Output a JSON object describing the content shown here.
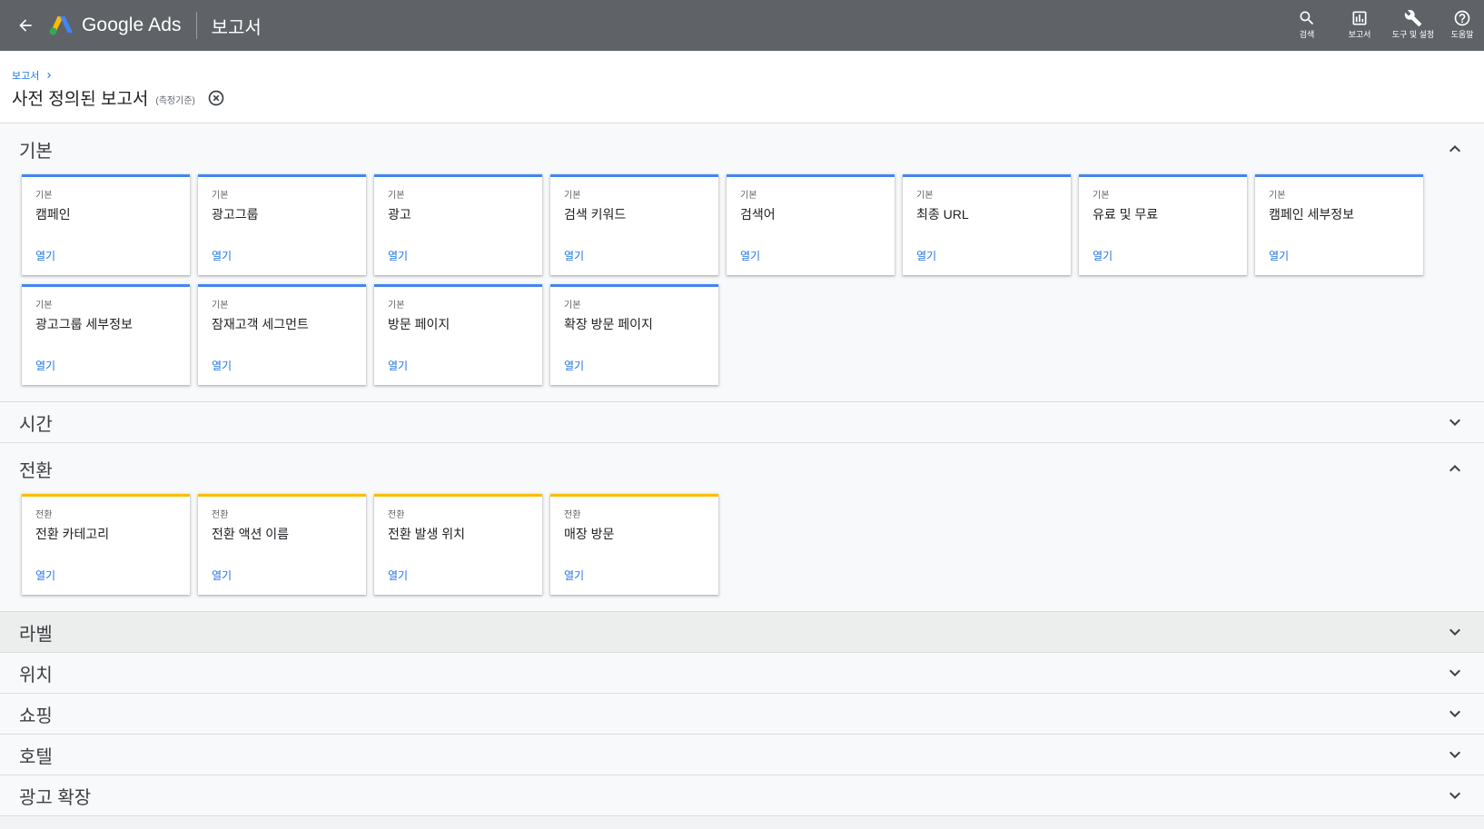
{
  "topbar": {
    "product_name": "Google Ads",
    "page_name": "보고서",
    "actions": [
      {
        "label": "검색",
        "icon": "search-icon"
      },
      {
        "label": "보고서",
        "icon": "reports-icon"
      },
      {
        "label": "도구 및 설정",
        "icon": "wrench-icon"
      },
      {
        "label": "도움말",
        "icon": "help-icon"
      }
    ]
  },
  "header": {
    "breadcrumb": "보고서",
    "title": "사전 정의된 보고서",
    "subnote": "(측정기준)"
  },
  "sections": {
    "basic": {
      "name": "기본",
      "cards": [
        {
          "category": "기본",
          "name": "캠페인",
          "open": "열기"
        },
        {
          "category": "기본",
          "name": "광고그룹",
          "open": "열기"
        },
        {
          "category": "기본",
          "name": "광고",
          "open": "열기"
        },
        {
          "category": "기본",
          "name": "검색 키워드",
          "open": "열기"
        },
        {
          "category": "기본",
          "name": "검색어",
          "open": "열기"
        },
        {
          "category": "기본",
          "name": "최종 URL",
          "open": "열기"
        },
        {
          "category": "기본",
          "name": "유료 및 무료",
          "open": "열기"
        },
        {
          "category": "기본",
          "name": "캠페인 세부정보",
          "open": "열기"
        },
        {
          "category": "기본",
          "name": "광고그룹 세부정보",
          "open": "열기"
        },
        {
          "category": "기본",
          "name": "잠재고객 세그먼트",
          "open": "열기"
        },
        {
          "category": "기본",
          "name": "방문 페이지",
          "open": "열기"
        },
        {
          "category": "기본",
          "name": "확장 방문 페이지",
          "open": "열기"
        }
      ]
    },
    "time": {
      "name": "시간"
    },
    "conversion": {
      "name": "전환",
      "cards": [
        {
          "category": "전환",
          "name": "전환 카테고리",
          "open": "열기"
        },
        {
          "category": "전환",
          "name": "전환 액션 이름",
          "open": "열기"
        },
        {
          "category": "전환",
          "name": "전환 발생 위치",
          "open": "열기"
        },
        {
          "category": "전환",
          "name": "매장 방문",
          "open": "열기"
        }
      ]
    },
    "label": {
      "name": "라벨"
    },
    "location": {
      "name": "위치"
    },
    "shopping": {
      "name": "쇼핑"
    },
    "hotel": {
      "name": "호텔"
    },
    "ad_extensions": {
      "name": "광고 확장"
    }
  },
  "colors": {
    "topbar": "#5f6368",
    "accent_blue": "#4285f4",
    "accent_yellow": "#fbbc04",
    "link_blue": "#1a73e8"
  }
}
